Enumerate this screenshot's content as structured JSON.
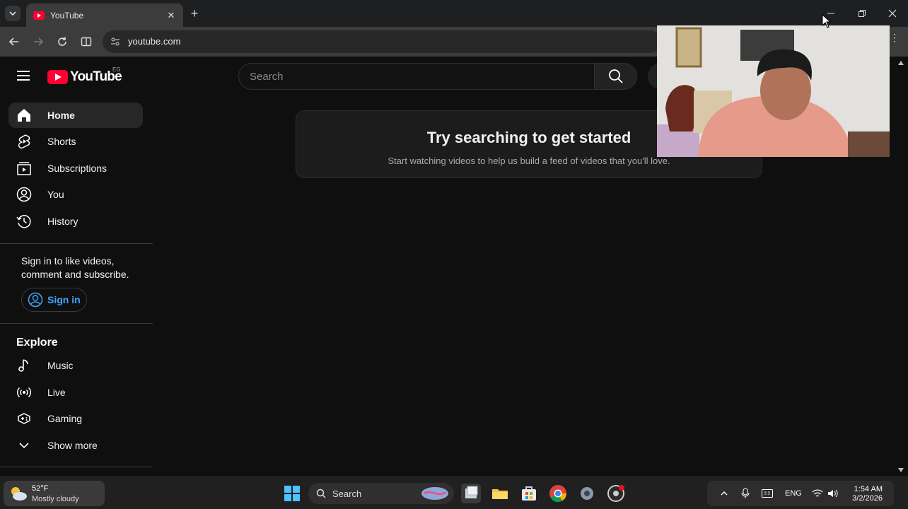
{
  "browser": {
    "tab_title": "YouTube",
    "url": "youtube.com"
  },
  "youtube": {
    "logo_text": "YouTube",
    "country_code": "EG",
    "search_placeholder": "Search",
    "sidebar": {
      "items": [
        {
          "label": "Home",
          "icon": "home-icon"
        },
        {
          "label": "Shorts",
          "icon": "shorts-icon"
        },
        {
          "label": "Subscriptions",
          "icon": "subscriptions-icon"
        },
        {
          "label": "You",
          "icon": "user-icon"
        },
        {
          "label": "History",
          "icon": "history-icon"
        }
      ],
      "signin_prompt": "Sign in to like videos, comment and subscribe.",
      "signin_label": "Sign in",
      "explore_title": "Explore",
      "explore_items": [
        {
          "label": "Music",
          "icon": "music-icon"
        },
        {
          "label": "Live",
          "icon": "live-icon"
        },
        {
          "label": "Gaming",
          "icon": "gaming-icon"
        },
        {
          "label": "Show more",
          "icon": "chevron-down-icon"
        }
      ]
    },
    "empty_state": {
      "heading": "Try searching to get started",
      "subtext": "Start watching videos to help us build a feed of videos that you'll love."
    }
  },
  "taskbar": {
    "weather_temp": "52°F",
    "weather_desc": "Mostly cloudy",
    "search_label": "Search",
    "language": "ENG",
    "time": "1:54 AM",
    "date": "3/2/2026"
  },
  "colors": {
    "accent_red": "#ff0033",
    "link_blue": "#3ea6ff"
  }
}
